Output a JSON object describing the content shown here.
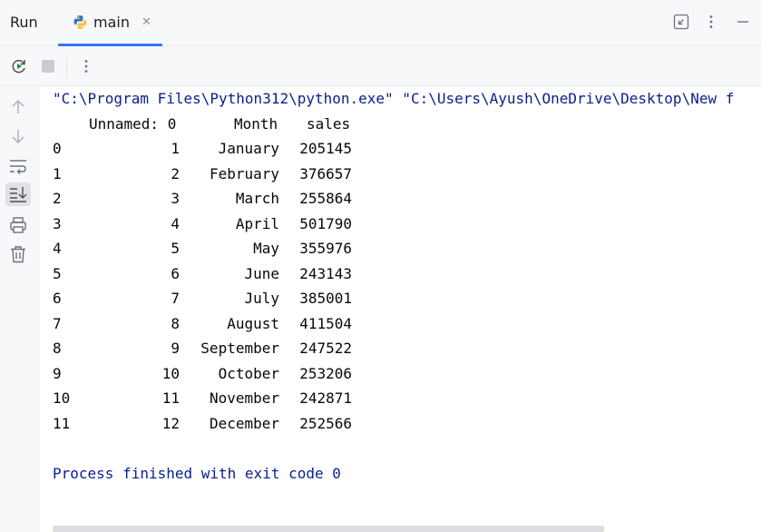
{
  "header": {
    "run_label": "Run",
    "tab_label": "main",
    "tab_icon": "python-icon",
    "accent": "#3574f0"
  },
  "console": {
    "command": "\"C:\\Program Files\\Python312\\python.exe\" \"C:\\Users\\Ayush\\OneDrive\\Desktop\\New f",
    "columns": [
      "",
      "Unnamed: 0",
      "Month",
      "sales"
    ],
    "rows": [
      [
        "0",
        "1",
        "January",
        "205145"
      ],
      [
        "1",
        "2",
        "February",
        "376657"
      ],
      [
        "2",
        "3",
        "March",
        "255864"
      ],
      [
        "3",
        "4",
        "April",
        "501790"
      ],
      [
        "4",
        "5",
        "May",
        "355976"
      ],
      [
        "5",
        "6",
        "June",
        "243143"
      ],
      [
        "6",
        "7",
        "July",
        "385001"
      ],
      [
        "7",
        "8",
        "August",
        "411504"
      ],
      [
        "8",
        "9",
        "September",
        "247522"
      ],
      [
        "9",
        "10",
        "October",
        "253206"
      ],
      [
        "10",
        "11",
        "November",
        "242871"
      ],
      [
        "11",
        "12",
        "December",
        "252566"
      ]
    ],
    "exit_message": "Process finished with exit code 0",
    "text_color": "#0a1e8c"
  }
}
